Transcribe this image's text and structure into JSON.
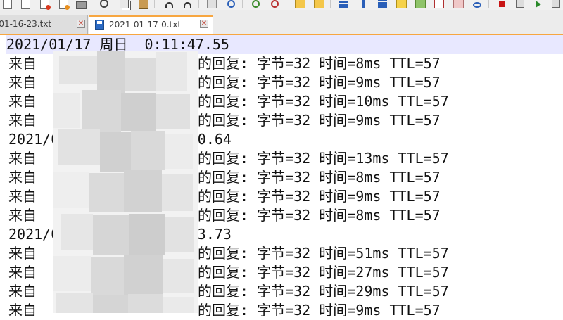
{
  "tabs": [
    {
      "label": "-01-16-23.txt",
      "active": false
    },
    {
      "label": "2021-01-17-0.txt",
      "active": true
    }
  ],
  "close_glyph": "✕",
  "accent": "#f7a640",
  "editor_lines": [
    {
      "kind": "timestamp",
      "text": "2021/01/17 周日  0:11:47.55",
      "current": true
    },
    {
      "kind": "reply",
      "prefix": "来自",
      "suffix": "的回复: 字节=32 时间=8ms TTL=57"
    },
    {
      "kind": "reply",
      "prefix": "来自",
      "suffix": "的回复: 字节=32 时间=9ms TTL=57"
    },
    {
      "kind": "reply",
      "prefix": "来自",
      "suffix": "的回复: 字节=32 时间=10ms TTL=57"
    },
    {
      "kind": "reply",
      "prefix": "来自",
      "suffix": "的回复: 字节=32 时间=9ms TTL=57"
    },
    {
      "kind": "timestamp",
      "text": "2021/01/17 周日  0:11:50.64"
    },
    {
      "kind": "reply",
      "prefix": "来自",
      "suffix": "的回复: 字节=32 时间=13ms TTL=57"
    },
    {
      "kind": "reply",
      "prefix": "来自",
      "suffix": "的回复: 字节=32 时间=8ms TTL=57"
    },
    {
      "kind": "reply",
      "prefix": "来自",
      "suffix": "的回复: 字节=32 时间=9ms TTL=57"
    },
    {
      "kind": "reply",
      "prefix": "来自",
      "suffix": "的回复: 字节=32 时间=8ms TTL=57"
    },
    {
      "kind": "timestamp",
      "text": "2021/01/17 周日  0:11:53.73"
    },
    {
      "kind": "reply",
      "prefix": "来自",
      "suffix": "的回复: 字节=32 时间=51ms TTL=57"
    },
    {
      "kind": "reply",
      "prefix": "来自",
      "suffix": "的回复: 字节=32 时间=27ms TTL=57"
    },
    {
      "kind": "reply",
      "prefix": "来自",
      "suffix": "的回复: 字节=32 时间=29ms TTL=57"
    },
    {
      "kind": "reply",
      "prefix": "来自",
      "suffix": "的回复: 字节=32 时间=9ms TTL=57"
    }
  ],
  "toolbar_icons": [
    "save-all-icon",
    "close-icon",
    "close-all-icon",
    "print-icon",
    "cut-icon",
    "copy-icon",
    "paste-icon",
    "undo-icon",
    "redo-icon",
    "find-icon",
    "find-replace-icon",
    "zoom-in-icon",
    "zoom-out-icon",
    "sync-vertical-icon",
    "sync-horizontal-icon",
    "word-wrap-icon",
    "show-all-chars-icon",
    "indent-guide-icon",
    "user-language-icon",
    "document-map-icon",
    "function-list-icon",
    "folder-workspace-icon",
    "monitoring-icon",
    "record-macro-icon",
    "stop-record-icon",
    "play-macro-icon"
  ],
  "colors": {
    "current_line": "#e8e8ff",
    "tab_accent": "#f7a640",
    "close_x": "#c0392b"
  }
}
